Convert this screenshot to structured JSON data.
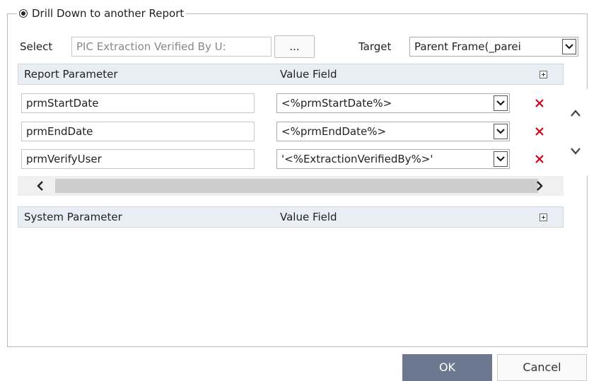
{
  "drilldown": {
    "radio_label": "Drill Down to another Report",
    "select_label": "Select",
    "select_value": "PIC Extraction Verified By U:",
    "browse_label": "...",
    "target_label": "Target",
    "target_value": "Parent Frame(_parei"
  },
  "report_params": {
    "header_col1": "Report Parameter",
    "header_col2": "Value Field",
    "rows": [
      {
        "name": "prmStartDate",
        "value": "<%prmStartDate%>"
      },
      {
        "name": "prmEndDate",
        "value": "<%prmEndDate%>"
      },
      {
        "name": "prmVerifyUser",
        "value": "'<%ExtractionVerifiedBy%>'"
      }
    ]
  },
  "system_params": {
    "header_col1": "System Parameter",
    "header_col2": "Value Field"
  },
  "icons": {
    "delete_color": "#d0021b",
    "header_bg": "#e9eef5",
    "ok_bg": "#6b7890"
  },
  "footer": {
    "ok_label": "OK",
    "cancel_label": "Cancel"
  }
}
